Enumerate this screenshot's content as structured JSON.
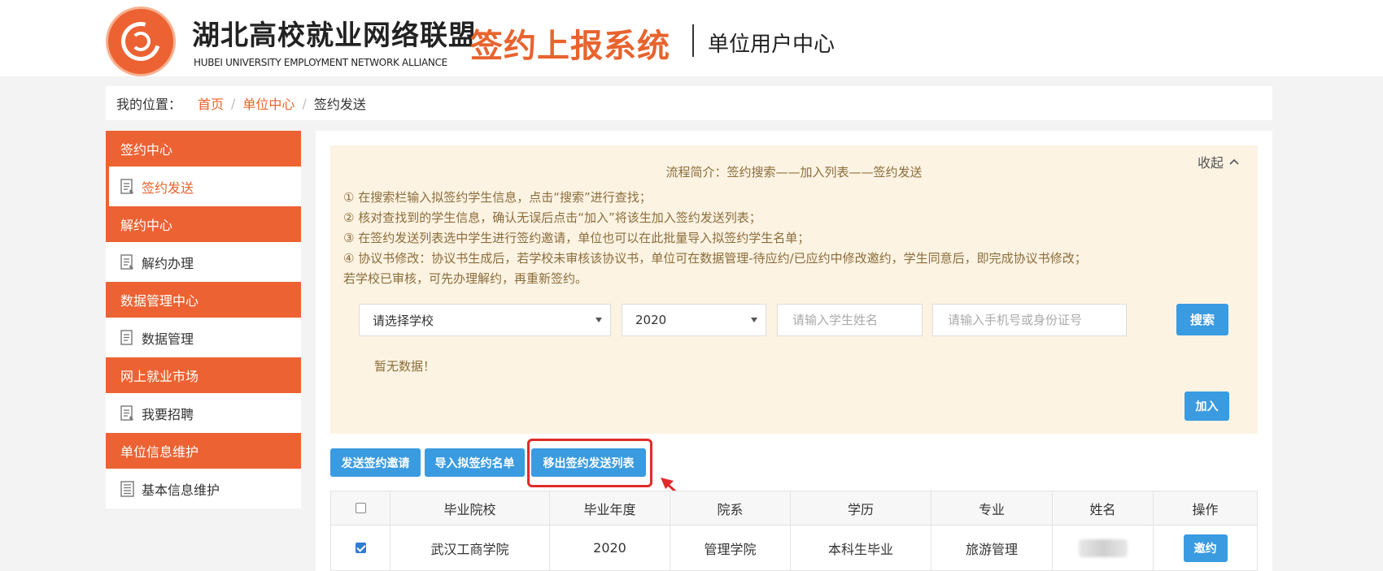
{
  "header": {
    "org_name": "湖北高校就业网络联盟",
    "org_en": "HUBEI UNIVERSITY EMPLOYMENT NETWORK ALLIANCE",
    "system_name": "签约上报系统",
    "user_center": "单位用户中心"
  },
  "breadcrumb": {
    "label": "我的位置：",
    "items": [
      "首页",
      "单位中心"
    ],
    "separator": "/",
    "current": "签约发送"
  },
  "sidebar": {
    "groups": [
      {
        "title": "签约中心",
        "item": "签约发送",
        "active": true
      },
      {
        "title": "解约中心",
        "item": "解约办理",
        "active": false
      },
      {
        "title": "数据管理中心",
        "item": "数据管理",
        "active": false
      },
      {
        "title": "网上就业市场",
        "item": "我要招聘",
        "active": false
      },
      {
        "title": "单位信息维护",
        "item": "基本信息维护",
        "active": false
      }
    ]
  },
  "notice": {
    "collapse_label": "收起",
    "flow_title": "流程简介：签约搜索——加入列表——签约发送",
    "steps": [
      "① 在搜索栏输入拟签约学生信息，点击“搜索”进行查找；",
      "② 核对查找到的学生信息，确认无误后点击“加入”将该生加入签约发送列表；",
      "③ 在签约发送列表选中学生进行签约邀请，单位也可以在此批量导入拟签约学生名单；",
      "④ 协议书修改：协议书生成后，若学校未审核该协议书，单位可在数据管理-待应约/已应约中修改邀约，学生同意后，即完成协议书修改；",
      "若学校已审核，可先办理解约，再重新签约。"
    ]
  },
  "search": {
    "school_select": "请选择学校",
    "year_select": "2020",
    "name_placeholder": "请输入学生姓名",
    "phone_placeholder": "请输入手机号或身份证号",
    "search_button": "搜索",
    "no_data": "暂无数据！",
    "add_button": "加入"
  },
  "actions": {
    "send_invite": "发送签约邀请",
    "import_list": "导入拟签约名单",
    "remove_from_list": "移出签约发送列表"
  },
  "table": {
    "headers": [
      "毕业院校",
      "毕业年度",
      "院系",
      "学历",
      "专业",
      "姓名",
      "操作"
    ],
    "rows": [
      {
        "checked": true,
        "school": "武汉工商学院",
        "year": "2020",
        "department": "管理学院",
        "education": "本科生毕业",
        "major": "旅游管理",
        "name_redacted": true,
        "action": "邀约"
      }
    ]
  },
  "colors": {
    "brand_orange": "#ec6233",
    "primary_blue": "#3a9be0",
    "notice_bg": "#fdf3e3",
    "notice_text": "#8a6d3b",
    "highlight_red": "#e02b2b"
  }
}
